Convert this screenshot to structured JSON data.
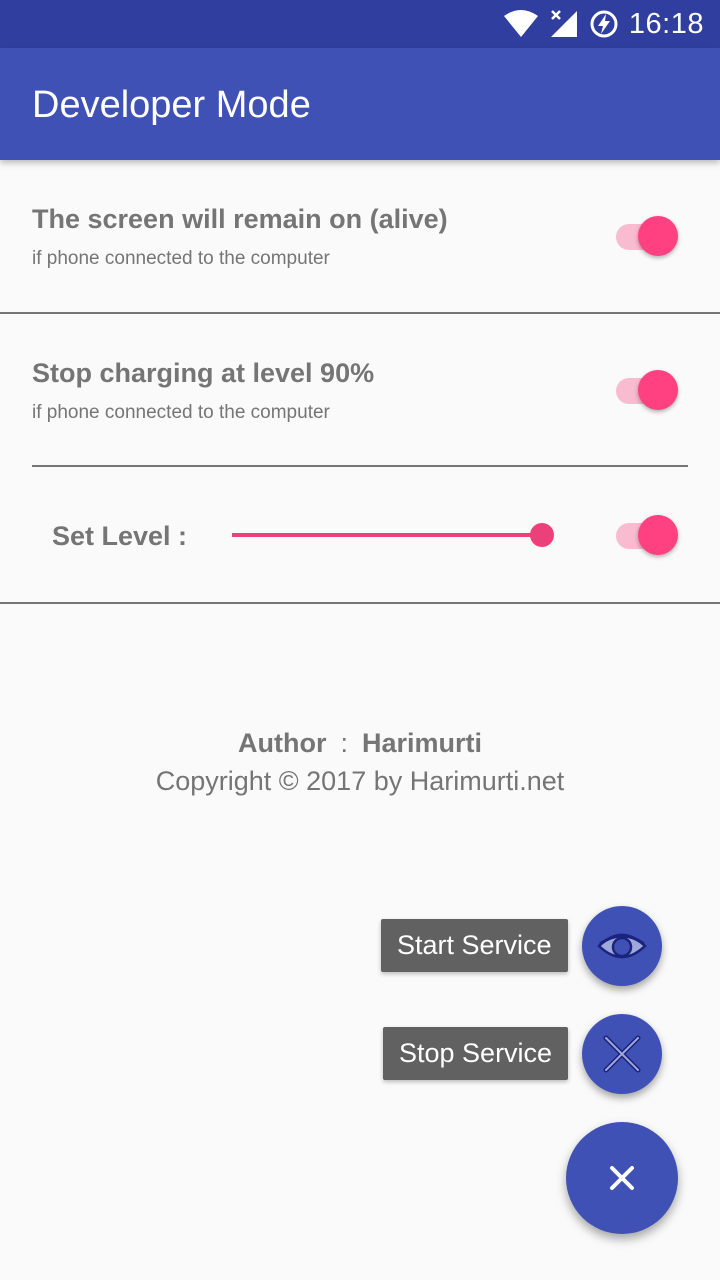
{
  "status_bar": {
    "time": "16:18",
    "icons": [
      "wifi-icon",
      "signal-icon",
      "battery-charging-icon"
    ]
  },
  "app_bar": {
    "title": "Developer Mode"
  },
  "settings": {
    "screen_alive": {
      "title": "The screen will remain on (alive)",
      "subtitle": "if phone connected to the computer",
      "enabled": true
    },
    "stop_charging": {
      "title": "Stop charging at level 90%",
      "subtitle": "if phone connected to the computer",
      "enabled": true
    },
    "set_level": {
      "label": "Set Level :",
      "slider_fraction": 1.0,
      "enabled": true
    }
  },
  "footer": {
    "author_label": "Author",
    "separator": ":",
    "author_name": "Harimurti",
    "copyright": "Copyright © 2017 by Harimurti.net"
  },
  "fab_menu": {
    "start_label": "Start Service",
    "stop_label": "Stop Service",
    "start_icon": "eye-icon",
    "stop_icon": "close-icon",
    "main_icon": "close-icon"
  },
  "colors": {
    "primary": "#3f51b5",
    "primary_dark": "#303f9f",
    "accent": "#ff4081",
    "text_secondary": "#757575"
  }
}
